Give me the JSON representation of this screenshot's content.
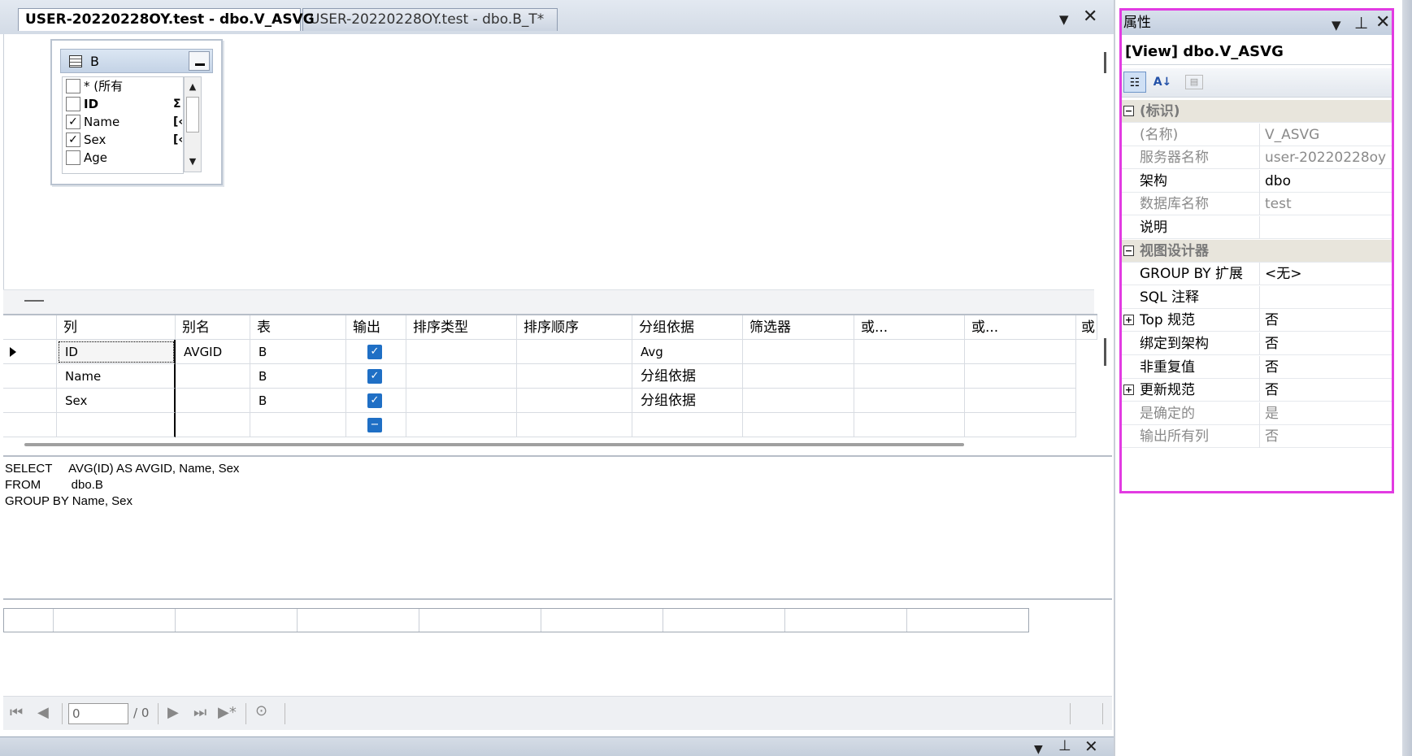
{
  "tabs": [
    {
      "label": "USER-20220228OY.test - dbo.V_ASVG",
      "active": true
    },
    {
      "label": "USER-20220228OY.test - dbo.B_T*",
      "active": false
    }
  ],
  "diagram": {
    "table_name": "B",
    "columns": [
      {
        "label": "* (所有",
        "checked": false,
        "mark": ""
      },
      {
        "label": "ID",
        "checked": false,
        "mark": "Σ"
      },
      {
        "label": "Name",
        "checked": true,
        "mark": "[‹="
      },
      {
        "label": "Sex",
        "checked": true,
        "mark": "[‹="
      },
      {
        "label": "Age",
        "checked": false,
        "mark": ""
      }
    ]
  },
  "criteria": {
    "headers": [
      "列",
      "别名",
      "表",
      "输出",
      "排序类型",
      "排序顺序",
      "分组依据",
      "筛选器",
      "或...",
      "或...",
      "或"
    ],
    "rows": [
      {
        "column": "ID",
        "alias": "AVGID",
        "table": "B",
        "output": true,
        "sort_type": "",
        "sort_order": "",
        "group_by": "Avg"
      },
      {
        "column": "Name",
        "alias": "",
        "table": "B",
        "output": true,
        "sort_type": "",
        "sort_order": "",
        "group_by": "分组依据"
      },
      {
        "column": "Sex",
        "alias": "",
        "table": "B",
        "output": true,
        "sort_type": "",
        "sort_order": "",
        "group_by": "分组依据"
      },
      {
        "column": "",
        "alias": "",
        "table": "",
        "output": false,
        "sort_type": "",
        "sort_order": "",
        "group_by": ""
      }
    ]
  },
  "sql": {
    "line1": "SELECT     AVG(ID) AS AVGID, Name, Sex",
    "line2": "FROM         dbo.B",
    "line3": "GROUP BY Name, Sex"
  },
  "navigator": {
    "current": "0",
    "total": "/ 0"
  },
  "properties": {
    "title": "属性",
    "object": "[View] dbo.V_ASVG",
    "rows": [
      {
        "name": "(标识)",
        "value": "",
        "category": true,
        "expander": "−",
        "dim": false
      },
      {
        "name": "(名称)",
        "value": "V_ASVG",
        "category": false,
        "expander": "",
        "dim": true
      },
      {
        "name": "服务器名称",
        "value": "user-20220228oy",
        "category": false,
        "expander": "",
        "dim": true
      },
      {
        "name": "架构",
        "value": "dbo",
        "category": false,
        "expander": "",
        "dim": false
      },
      {
        "name": "数据库名称",
        "value": "test",
        "category": false,
        "expander": "",
        "dim": true
      },
      {
        "name": "说明",
        "value": "",
        "category": false,
        "expander": "",
        "dim": false
      },
      {
        "name": "视图设计器",
        "value": "",
        "category": true,
        "expander": "−",
        "dim": false
      },
      {
        "name": "GROUP BY 扩展",
        "value": "<无>",
        "category": false,
        "expander": "",
        "dim": false
      },
      {
        "name": "SQL 注释",
        "value": "",
        "category": false,
        "expander": "",
        "dim": false
      },
      {
        "name": "Top 规范",
        "value": "否",
        "category": false,
        "expander": "+",
        "dim": false
      },
      {
        "name": "绑定到架构",
        "value": "否",
        "category": false,
        "expander": "",
        "dim": false
      },
      {
        "name": "非重复值",
        "value": "否",
        "category": false,
        "expander": "",
        "dim": false
      },
      {
        "name": "更新规范",
        "value": "否",
        "category": false,
        "expander": "+",
        "dim": false
      },
      {
        "name": "是确定的",
        "value": "是",
        "category": false,
        "expander": "",
        "dim": true
      },
      {
        "name": "输出所有列",
        "value": "否",
        "category": false,
        "expander": "",
        "dim": true
      }
    ]
  },
  "colors": {
    "selection_outline": "#e23be2",
    "checkbox_blue": "#1f6fc5"
  },
  "icons": {
    "doc_dropdown": "▼",
    "doc_close": "✕",
    "pin": "⊥"
  }
}
